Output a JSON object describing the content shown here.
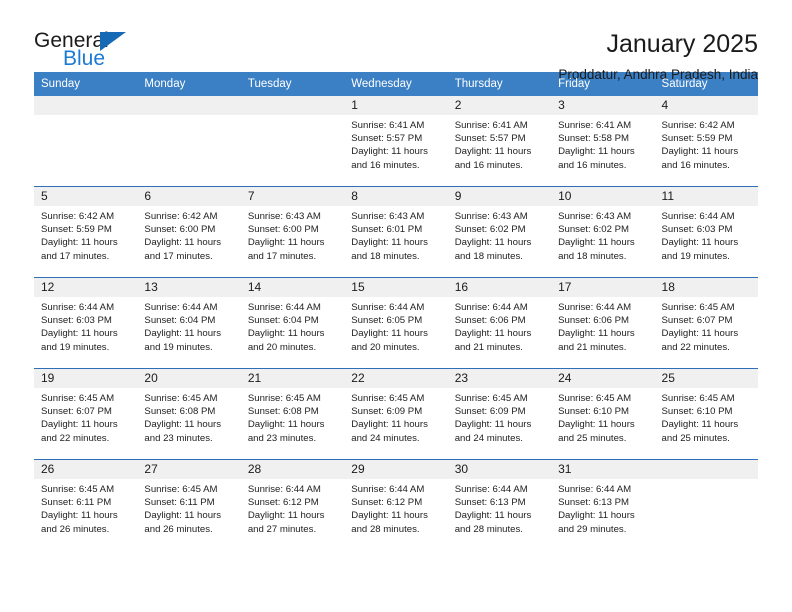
{
  "logo": {
    "word1": "General",
    "word2": "Blue",
    "triangle_color": "#1669b5",
    "blue_color": "#1c7ad1"
  },
  "header": {
    "title": "January 2025",
    "subtitle": "Proddatur, Andhra Pradesh, India"
  },
  "theme": {
    "header_bg": "#3b7fc4",
    "cell_border": "#2f6fb5",
    "daynum_bg": "#f0f0f0"
  },
  "calendar": {
    "weekday_headers": [
      "Sunday",
      "Monday",
      "Tuesday",
      "Wednesday",
      "Thursday",
      "Friday",
      "Saturday"
    ],
    "weeks": [
      [
        {
          "day": "",
          "lines": []
        },
        {
          "day": "",
          "lines": []
        },
        {
          "day": "",
          "lines": []
        },
        {
          "day": "1",
          "lines": [
            "Sunrise: 6:41 AM",
            "Sunset: 5:57 PM",
            "Daylight: 11 hours",
            "and 16 minutes."
          ]
        },
        {
          "day": "2",
          "lines": [
            "Sunrise: 6:41 AM",
            "Sunset: 5:57 PM",
            "Daylight: 11 hours",
            "and 16 minutes."
          ]
        },
        {
          "day": "3",
          "lines": [
            "Sunrise: 6:41 AM",
            "Sunset: 5:58 PM",
            "Daylight: 11 hours",
            "and 16 minutes."
          ]
        },
        {
          "day": "4",
          "lines": [
            "Sunrise: 6:42 AM",
            "Sunset: 5:59 PM",
            "Daylight: 11 hours",
            "and 16 minutes."
          ]
        }
      ],
      [
        {
          "day": "5",
          "lines": [
            "Sunrise: 6:42 AM",
            "Sunset: 5:59 PM",
            "Daylight: 11 hours",
            "and 17 minutes."
          ]
        },
        {
          "day": "6",
          "lines": [
            "Sunrise: 6:42 AM",
            "Sunset: 6:00 PM",
            "Daylight: 11 hours",
            "and 17 minutes."
          ]
        },
        {
          "day": "7",
          "lines": [
            "Sunrise: 6:43 AM",
            "Sunset: 6:00 PM",
            "Daylight: 11 hours",
            "and 17 minutes."
          ]
        },
        {
          "day": "8",
          "lines": [
            "Sunrise: 6:43 AM",
            "Sunset: 6:01 PM",
            "Daylight: 11 hours",
            "and 18 minutes."
          ]
        },
        {
          "day": "9",
          "lines": [
            "Sunrise: 6:43 AM",
            "Sunset: 6:02 PM",
            "Daylight: 11 hours",
            "and 18 minutes."
          ]
        },
        {
          "day": "10",
          "lines": [
            "Sunrise: 6:43 AM",
            "Sunset: 6:02 PM",
            "Daylight: 11 hours",
            "and 18 minutes."
          ]
        },
        {
          "day": "11",
          "lines": [
            "Sunrise: 6:44 AM",
            "Sunset: 6:03 PM",
            "Daylight: 11 hours",
            "and 19 minutes."
          ]
        }
      ],
      [
        {
          "day": "12",
          "lines": [
            "Sunrise: 6:44 AM",
            "Sunset: 6:03 PM",
            "Daylight: 11 hours",
            "and 19 minutes."
          ]
        },
        {
          "day": "13",
          "lines": [
            "Sunrise: 6:44 AM",
            "Sunset: 6:04 PM",
            "Daylight: 11 hours",
            "and 19 minutes."
          ]
        },
        {
          "day": "14",
          "lines": [
            "Sunrise: 6:44 AM",
            "Sunset: 6:04 PM",
            "Daylight: 11 hours",
            "and 20 minutes."
          ]
        },
        {
          "day": "15",
          "lines": [
            "Sunrise: 6:44 AM",
            "Sunset: 6:05 PM",
            "Daylight: 11 hours",
            "and 20 minutes."
          ]
        },
        {
          "day": "16",
          "lines": [
            "Sunrise: 6:44 AM",
            "Sunset: 6:06 PM",
            "Daylight: 11 hours",
            "and 21 minutes."
          ]
        },
        {
          "day": "17",
          "lines": [
            "Sunrise: 6:44 AM",
            "Sunset: 6:06 PM",
            "Daylight: 11 hours",
            "and 21 minutes."
          ]
        },
        {
          "day": "18",
          "lines": [
            "Sunrise: 6:45 AM",
            "Sunset: 6:07 PM",
            "Daylight: 11 hours",
            "and 22 minutes."
          ]
        }
      ],
      [
        {
          "day": "19",
          "lines": [
            "Sunrise: 6:45 AM",
            "Sunset: 6:07 PM",
            "Daylight: 11 hours",
            "and 22 minutes."
          ]
        },
        {
          "day": "20",
          "lines": [
            "Sunrise: 6:45 AM",
            "Sunset: 6:08 PM",
            "Daylight: 11 hours",
            "and 23 minutes."
          ]
        },
        {
          "day": "21",
          "lines": [
            "Sunrise: 6:45 AM",
            "Sunset: 6:08 PM",
            "Daylight: 11 hours",
            "and 23 minutes."
          ]
        },
        {
          "day": "22",
          "lines": [
            "Sunrise: 6:45 AM",
            "Sunset: 6:09 PM",
            "Daylight: 11 hours",
            "and 24 minutes."
          ]
        },
        {
          "day": "23",
          "lines": [
            "Sunrise: 6:45 AM",
            "Sunset: 6:09 PM",
            "Daylight: 11 hours",
            "and 24 minutes."
          ]
        },
        {
          "day": "24",
          "lines": [
            "Sunrise: 6:45 AM",
            "Sunset: 6:10 PM",
            "Daylight: 11 hours",
            "and 25 minutes."
          ]
        },
        {
          "day": "25",
          "lines": [
            "Sunrise: 6:45 AM",
            "Sunset: 6:10 PM",
            "Daylight: 11 hours",
            "and 25 minutes."
          ]
        }
      ],
      [
        {
          "day": "26",
          "lines": [
            "Sunrise: 6:45 AM",
            "Sunset: 6:11 PM",
            "Daylight: 11 hours",
            "and 26 minutes."
          ]
        },
        {
          "day": "27",
          "lines": [
            "Sunrise: 6:45 AM",
            "Sunset: 6:11 PM",
            "Daylight: 11 hours",
            "and 26 minutes."
          ]
        },
        {
          "day": "28",
          "lines": [
            "Sunrise: 6:44 AM",
            "Sunset: 6:12 PM",
            "Daylight: 11 hours",
            "and 27 minutes."
          ]
        },
        {
          "day": "29",
          "lines": [
            "Sunrise: 6:44 AM",
            "Sunset: 6:12 PM",
            "Daylight: 11 hours",
            "and 28 minutes."
          ]
        },
        {
          "day": "30",
          "lines": [
            "Sunrise: 6:44 AM",
            "Sunset: 6:13 PM",
            "Daylight: 11 hours",
            "and 28 minutes."
          ]
        },
        {
          "day": "31",
          "lines": [
            "Sunrise: 6:44 AM",
            "Sunset: 6:13 PM",
            "Daylight: 11 hours",
            "and 29 minutes."
          ]
        },
        {
          "day": "",
          "lines": []
        }
      ]
    ]
  }
}
